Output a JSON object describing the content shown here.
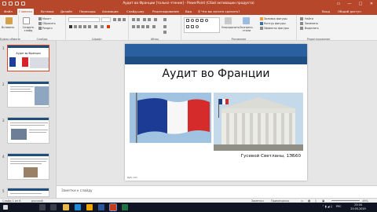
{
  "titlebar": {
    "title": "Аудит во Франции [только чтение] - PowerPoint (Сбой активации продукта)"
  },
  "tabs": [
    {
      "label": "Файл"
    },
    {
      "label": "Главная"
    },
    {
      "label": "Вставка"
    },
    {
      "label": "Дизайн"
    },
    {
      "label": "Переходы"
    },
    {
      "label": "Анимация"
    },
    {
      "label": "Слайд-шоу"
    },
    {
      "label": "Рецензирование"
    },
    {
      "label": "Вид"
    }
  ],
  "tell_me": "♀ Что вы хотите сделать?",
  "signin": "Вход",
  "share": "Общий доступ",
  "ribbon": {
    "clipboard": {
      "paste": "Вставить",
      "label": "Буфер обмена"
    },
    "slides": {
      "new_slide": "Создать слайд",
      "layout": "Макет",
      "reset": "Сбросить",
      "section": "Раздел",
      "label": "Слайды"
    },
    "font": {
      "label": "Шрифт"
    },
    "paragraph": {
      "label": "Абзац"
    },
    "drawing": {
      "arrange": "Упорядочить",
      "quick_styles": "Экспресс-стили",
      "fill": "Заливка фигуры",
      "outline": "Контур фигуры",
      "effects": "Эффекты фигуры",
      "label": "Рисование"
    },
    "editing": {
      "find": "Найти",
      "replace": "Заменить",
      "select": "Выделить",
      "label": "Редактирование"
    }
  },
  "thumbnails": [
    {
      "number": "1",
      "title": "Аудит во Франции"
    },
    {
      "number": "2"
    },
    {
      "number": "3"
    },
    {
      "number": "4"
    },
    {
      "number": "5"
    }
  ],
  "slide": {
    "title": "Аудит во Франции",
    "subtitle": "Гусевой Светланы, 1ЭБ60",
    "footer": "Ryfu.com"
  },
  "notes_placeholder": "Заметки к слайду",
  "status": {
    "slide_info": "Слайд 1 из 6",
    "language": "русский",
    "notes": "Заметки",
    "comments": "Примечания",
    "zoom": "49%"
  },
  "taskbar": {
    "language": "РУС",
    "time": "23:04",
    "date": "20.05.2019"
  },
  "colors": {
    "accent": "#b7472a",
    "slide_header": "#2a5fa0",
    "taskbar": "#101523"
  }
}
